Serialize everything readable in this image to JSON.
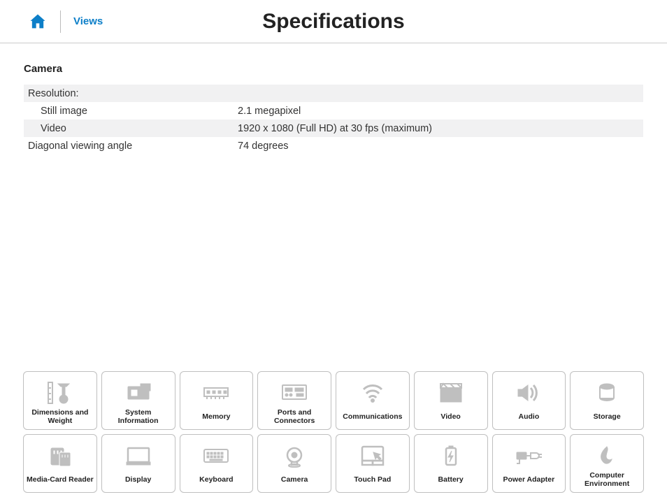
{
  "header": {
    "views_link": "Views",
    "page_title": "Specifications"
  },
  "section": {
    "title": "Camera",
    "rows": [
      {
        "label": "Resolution:",
        "value": "",
        "shaded": true,
        "indent": false
      },
      {
        "label": "Still image",
        "value": "2.1 megapixel",
        "shaded": false,
        "indent": true
      },
      {
        "label": "Video",
        "value": "1920 x 1080 (Full HD) at 30 fps (maximum)",
        "shaded": true,
        "indent": true
      },
      {
        "label": "Diagonal viewing angle",
        "value": "74 degrees",
        "shaded": false,
        "indent": false
      }
    ]
  },
  "nav": [
    {
      "id": "dimensions",
      "label": "Dimensions and Weight"
    },
    {
      "id": "system-info",
      "label": "System Information"
    },
    {
      "id": "memory",
      "label": "Memory"
    },
    {
      "id": "ports",
      "label": "Ports and Connectors"
    },
    {
      "id": "communications",
      "label": "Communications"
    },
    {
      "id": "video",
      "label": "Video"
    },
    {
      "id": "audio",
      "label": "Audio"
    },
    {
      "id": "storage",
      "label": "Storage"
    },
    {
      "id": "media-card",
      "label": "Media-Card Reader"
    },
    {
      "id": "display",
      "label": "Display"
    },
    {
      "id": "keyboard",
      "label": "Keyboard"
    },
    {
      "id": "camera",
      "label": "Camera"
    },
    {
      "id": "touchpad",
      "label": "Touch Pad"
    },
    {
      "id": "battery",
      "label": "Battery"
    },
    {
      "id": "power-adapter",
      "label": "Power Adapter"
    },
    {
      "id": "environment",
      "label": "Computer Environment"
    }
  ]
}
